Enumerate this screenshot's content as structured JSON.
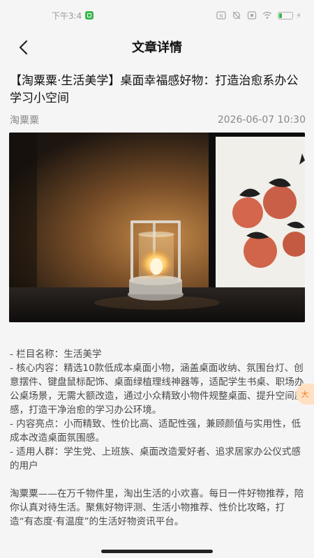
{
  "status_bar": {
    "time": "下午3:4",
    "battery_level": 0.2,
    "icons": [
      "notification-badge-icon",
      "nfc-icon",
      "mute-icon",
      "sim-icon",
      "wifi-icon",
      "battery-icon",
      "charging-icon"
    ]
  },
  "header": {
    "back_icon": "chevron-left-icon",
    "title": "文章详情"
  },
  "article": {
    "title": "【淘粟粟·生活美学】桌面幸福感好物：打造治愈系办公学习小空间",
    "author": "淘粟粟",
    "datetime": "2026-06-07 10:30",
    "image": "desk-lamp-photo",
    "paragraphs": [
      "- 栏目名称：生活美学",
      "- 核心内容：精选10款低成本桌面小物，涵盖桌面收纳、氛围台灯、创意摆件、键盘鼠标配饰、桌面绿植理线神器等，适配学生书桌、职场办公桌场景，无需大额改造，通过小众精致小物件规整桌面、提升空间质感，打造干净治愈的学习办公环境。",
      "- 内容亮点：小而精致、性价比高、适配性强，兼顾颜值与实用性，低成本改造桌面氛围感。",
      "- 适用人群：学生党、上班族、桌面改造爱好者、追求居家办公仪式感的用户"
    ],
    "closing": "淘粟粟——在万千物件里，淘出生活的小欢喜。每日一件好物推荐，陪你认真对待生活。聚焦好物评测、生活小物推荐、性价比攻略，打造“有态度·有温度”的生活好物资讯平台。"
  },
  "float_badge": {
    "label": "大"
  },
  "colors": {
    "background": "#f5f5f5",
    "accent": "#f07a1c",
    "meta": "#888888"
  }
}
